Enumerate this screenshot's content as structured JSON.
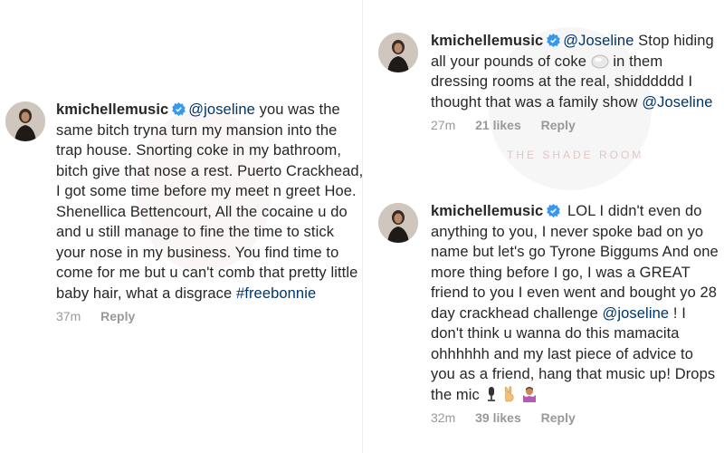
{
  "watermark": {
    "text": "THE SHADE ROOM"
  },
  "comments": [
    {
      "username": "kmichellemusic",
      "mention": "@joseline",
      "text": " you was the same bitch tryna turn my mansion into the trap house. Snorting coke in my bathroom, bitch give that nose a rest. Puerto Crackhead, I got some time before my meet n greet Hoe. Shenellica Bettencourt, All the cocaine u do and u still manage to fine the time to stick your nose in my business. You find time to come for me but u can't comb that pretty little baby hair, what a disgrace ",
      "hashtag": "#freebonnie",
      "time": "37m",
      "likes": "",
      "reply": "Reply"
    },
    {
      "username": "kmichellemusic",
      "mention": "@Joseline",
      "text_a": " Stop hiding all your pounds of coke ",
      "text_b": " in them dressing rooms at the real, shidddddd I thought that was a family show ",
      "mention_end": "@Joseline",
      "time": "27m",
      "likes": "21 likes",
      "reply": "Reply"
    },
    {
      "username": "kmichellemusic",
      "text_a": " LOL I didn't even do anything to you, I never spoke bad on yo name but let's go Tyrone Biggums And one more thing before I go, I was a GREAT friend to you I even went and bought yo 28 day crackhead challenge ",
      "mention": "@joseline",
      "text_b": " ! I don't think u wanna do this mamacita ohhhhhh and my last piece of advice to you as a friend, hang that music up! Drops the mic ",
      "time": "32m",
      "likes": "39 likes",
      "reply": "Reply"
    }
  ]
}
